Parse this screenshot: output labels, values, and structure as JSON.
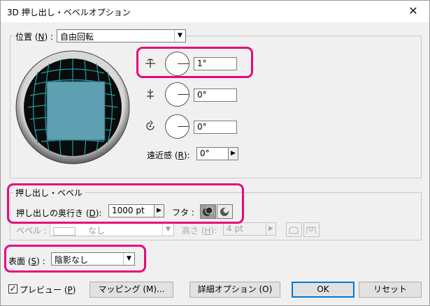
{
  "window": {
    "title": "3D 押し出し・ベベルオプション",
    "close_glyph": "✕"
  },
  "position": {
    "group_label_prefix": "位置 (",
    "group_label_key": "N",
    "group_label_suffix": ") :",
    "select_value": "自由回転",
    "rotate_x": "1°",
    "rotate_y": "0°",
    "rotate_z": "0°",
    "perspective_prefix": "遠近感 (",
    "perspective_key": "R",
    "perspective_suffix": "):",
    "perspective_value": "0°"
  },
  "extrude": {
    "group_label": "押し出し・ベベル",
    "depth_prefix": "押し出しの奥行き (",
    "depth_key": "D",
    "depth_suffix": "):",
    "depth_value": "1000 pt",
    "cap_label": "フタ :",
    "bevel_label": "ベベル :",
    "bevel_value": "なし",
    "height_prefix": "高さ (",
    "height_key": "H",
    "height_suffix": "):",
    "height_value": "4 pt"
  },
  "surface": {
    "label_prefix": "表面 (",
    "label_key": "S",
    "label_suffix": ") :",
    "value": "陰影なし"
  },
  "footer": {
    "preview_prefix": "プレビュー (",
    "preview_key": "P",
    "preview_suffix": ")",
    "preview_checked": "✓",
    "mapping": "マッピング (M)...",
    "details": "詳細オプション (O)",
    "ok": "OK",
    "reset": "リセット"
  },
  "icons": [
    "close-icon",
    "rotate-x-icon",
    "rotate-y-icon",
    "rotate-z-icon",
    "cap-on-icon",
    "cap-off-icon",
    "dropdown-arrow-icon",
    "checkbox-icon"
  ],
  "colors": {
    "highlight": "#e8087a",
    "cube_face": "#5f9fb2",
    "grid_line": "#16a3a8",
    "default_button_border": "#0078d7"
  }
}
